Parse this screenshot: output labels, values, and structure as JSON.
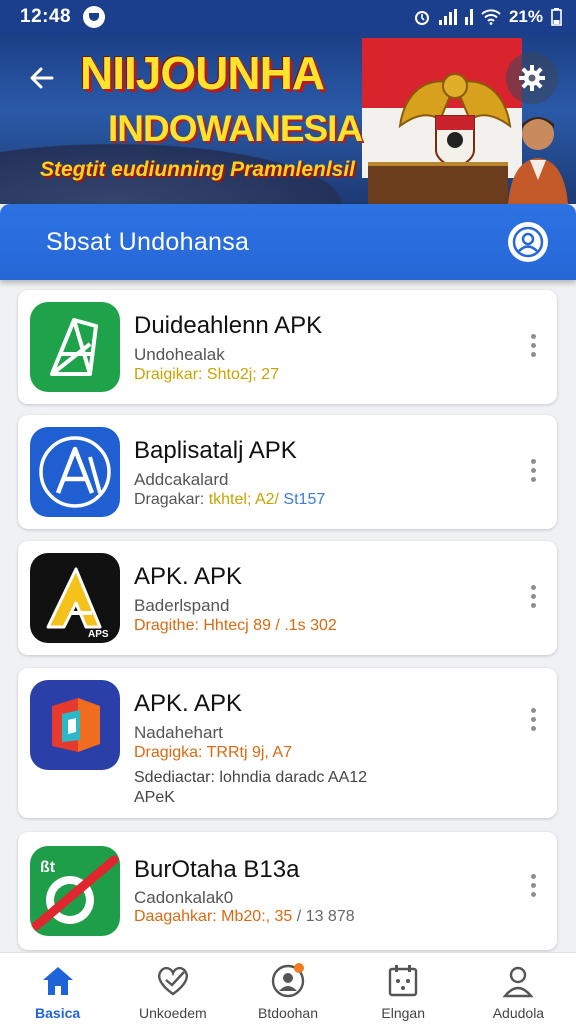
{
  "status_bar": {
    "time": "12:48",
    "battery": "21%"
  },
  "hero": {
    "title_line1": "NIIJOUNHA",
    "title_line2": "INDOWANESIA",
    "tagline": "Stegtit eudiunning Pramnlenlsil"
  },
  "header": {
    "title": "Sbsat Undohansa"
  },
  "apps": [
    {
      "name": "Duideahlenn APK",
      "subtitle": "Undohealak",
      "meta_label": "Draigikar:",
      "meta_value": "Shto2j; 27",
      "meta_extra": ""
    },
    {
      "name": "Baplisatalj APK",
      "subtitle": "Addcakalard",
      "meta_label": "Dragakar:",
      "meta_value": "tkhtel; A2/",
      "meta_extra": "St157"
    },
    {
      "name": "APK. APK",
      "subtitle": "Baderlspand",
      "meta_label": "Dragithe:",
      "meta_value": "Hhtecj 89",
      "meta_extra": "/ .1s 302"
    },
    {
      "name": "APK. APK",
      "subtitle": "Nadahehart",
      "meta_label": "Dragigka:",
      "meta_value": "TRRtj 9j, A7",
      "meta_extra": "",
      "extra_line1": "Sdediactar: lohndia daradc AA12",
      "extra_line2": "APeK"
    },
    {
      "name": "BurOtaha B13a",
      "subtitle": "Cadonkalak0",
      "meta_label": "Daagahkar:",
      "meta_value": "Mb20:, 35",
      "meta_extra": "/ 13 878"
    }
  ],
  "bottom_nav": [
    {
      "label": "Basica",
      "icon": "home-icon",
      "active": true
    },
    {
      "label": "Unkoedem",
      "icon": "heart-check-icon",
      "active": false
    },
    {
      "label": "Btdoohan",
      "icon": "profile-badge-icon",
      "active": false
    },
    {
      "label": "Elngan",
      "icon": "calendar-icon",
      "active": false
    },
    {
      "label": "Adudola",
      "icon": "user-icon",
      "active": false
    }
  ],
  "colors": {
    "primary": "#2767d6",
    "status_bar": "#1b3f8c",
    "meta_yellow": "#c9a400",
    "meta_orange": "#d86a12"
  }
}
